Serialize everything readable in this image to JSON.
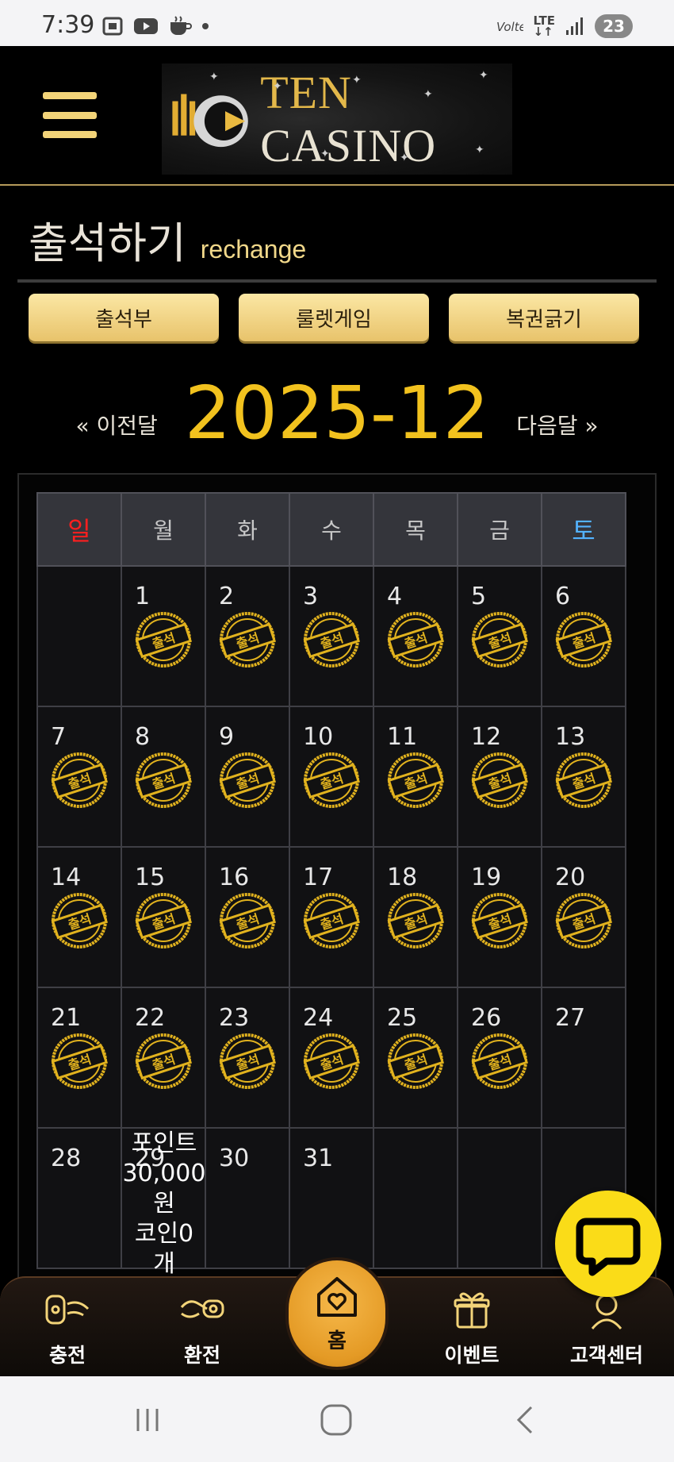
{
  "status_bar": {
    "time": "7:39",
    "network": "LTE",
    "battery": "23"
  },
  "header": {
    "logo_text_ten": "TEN",
    "logo_text_casino": " CASINO"
  },
  "page": {
    "title": "출석하기",
    "subtitle": "rechange"
  },
  "tabs": [
    {
      "label": "출석부"
    },
    {
      "label": "룰렛게임"
    },
    {
      "label": "복권긁기"
    }
  ],
  "month_nav": {
    "prev": "« 이전달",
    "current": "2025-12",
    "next": "다음달 »"
  },
  "calendar": {
    "weekdays": [
      "일",
      "월",
      "화",
      "수",
      "목",
      "금",
      "토"
    ],
    "stamp_label": "출석",
    "weeks": [
      [
        {
          "day": ""
        },
        {
          "day": "1",
          "attended": true
        },
        {
          "day": "2",
          "attended": true
        },
        {
          "day": "3",
          "attended": true
        },
        {
          "day": "4",
          "attended": true
        },
        {
          "day": "5",
          "attended": true
        },
        {
          "day": "6",
          "attended": true
        }
      ],
      [
        {
          "day": "7",
          "attended": true
        },
        {
          "day": "8",
          "attended": true
        },
        {
          "day": "9",
          "attended": true
        },
        {
          "day": "10",
          "attended": true
        },
        {
          "day": "11",
          "attended": true
        },
        {
          "day": "12",
          "attended": true
        },
        {
          "day": "13",
          "attended": true
        }
      ],
      [
        {
          "day": "14",
          "attended": true
        },
        {
          "day": "15",
          "attended": true
        },
        {
          "day": "16",
          "attended": true
        },
        {
          "day": "17",
          "attended": true
        },
        {
          "day": "18",
          "attended": true
        },
        {
          "day": "19",
          "attended": true
        },
        {
          "day": "20",
          "attended": true
        }
      ],
      [
        {
          "day": "21",
          "attended": true
        },
        {
          "day": "22",
          "attended": true
        },
        {
          "day": "23",
          "attended": true
        },
        {
          "day": "24",
          "attended": true
        },
        {
          "day": "25",
          "attended": true
        },
        {
          "day": "26",
          "attended": true
        },
        {
          "day": "27",
          "attended": false
        }
      ],
      [
        {
          "day": "28"
        },
        {
          "day": "29"
        },
        {
          "day": "30"
        },
        {
          "day": "31"
        },
        {
          "day": ""
        },
        {
          "day": ""
        },
        {
          "day": ""
        }
      ]
    ],
    "today_overlay": {
      "day": "29",
      "lines": [
        "포인트",
        "30,000",
        "원",
        "코인0",
        "개"
      ]
    }
  },
  "bottom_nav": {
    "items": [
      {
        "label": "충전"
      },
      {
        "label": "환전"
      },
      {
        "label": "홈"
      },
      {
        "label": "이벤트"
      },
      {
        "label": "고객센터"
      }
    ]
  },
  "colors": {
    "gold": "#f2c21e",
    "button_gold": "#f3d479",
    "sunday": "#ff1f1f",
    "saturday": "#53b3ff",
    "chat_yellow": "#fadc18"
  }
}
